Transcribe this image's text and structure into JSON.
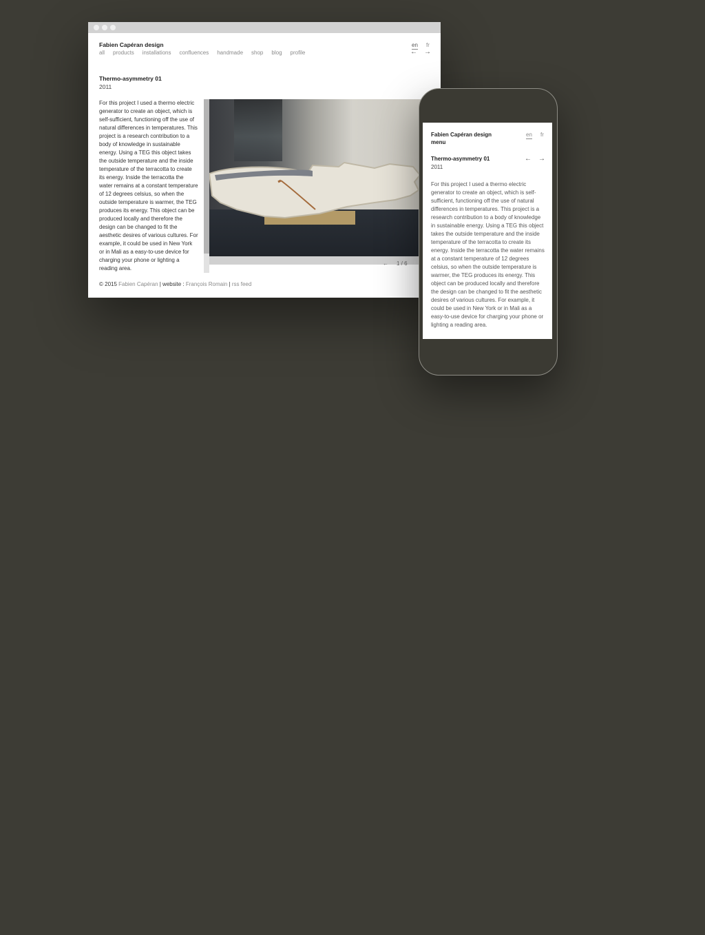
{
  "desktop": {
    "site_title": "Fabien Capéran design",
    "nav": [
      "all",
      "products",
      "installations",
      "confluences",
      "handmade",
      "shop",
      "blog",
      "profile"
    ],
    "lang": {
      "en": "en",
      "fr": "fr"
    },
    "arrows": {
      "prev": "←",
      "next": "→"
    },
    "project": {
      "title": "Thermo-asymmetry 01",
      "year": "2011",
      "description": "For this project I used a thermo electric generator to create an object, which is self-sufficient, functioning off the use of natural differences in temperatures. This project is a research contribution to a body of knowledge in sustainable energy. Using a TEG this object takes the outside temperature and the inside temperature of the terracotta to create its energy. Inside the terracotta the water remains at a constant temperature of 12 degrees celsius, so when the outside temperature is warmer, the TEG produces its energy. This object can be produced locally and therefore the design can be changed to fit the aesthetic desires of various cultures. For example, it could be used in New York or in Mali as a easy-to-use device for charging your phone or lighting a reading area."
    },
    "pager": {
      "prev": "←",
      "count": "1 / 6"
    },
    "footer": {
      "copyright": "© 2015 ",
      "author": "Fabien Capéran",
      "sep1": " | ",
      "website_label": "website : ",
      "website_author": "François Romain",
      "sep2": " | ",
      "rss": "rss feed"
    }
  },
  "mobile": {
    "site_title": "Fabien Capéran design",
    "menu": "menu",
    "lang": {
      "en": "en",
      "fr": "fr"
    },
    "arrows": {
      "prev": "←",
      "next": "→"
    },
    "project": {
      "title": "Thermo-asymmetry 01",
      "year": "2011",
      "description": "For this project I used a thermo electric generator to create an object, which is self-sufficient, functioning off the use of natural differences in temperatures. This project is a research contribution to a body of knowledge in sustainable energy. Using a TEG this object takes the outside temperature and the inside temperature of the terracotta to create its energy. Inside the terracotta the water remains at a constant temperature of 12 degrees celsius, so when the outside temperature is warmer, the TEG produces its energy. This object can be produced locally and therefore the design can be changed to fit the aesthetic desires of various cultures. For example, it could be used in New York or in Mali as a easy-to-use device for charging your phone or lighting a reading area."
    }
  },
  "colors": {
    "background": "#3d3c35",
    "page": "#ffffff",
    "muted_text": "#8a8a8a",
    "titlebar": "#d2d2d2"
  }
}
